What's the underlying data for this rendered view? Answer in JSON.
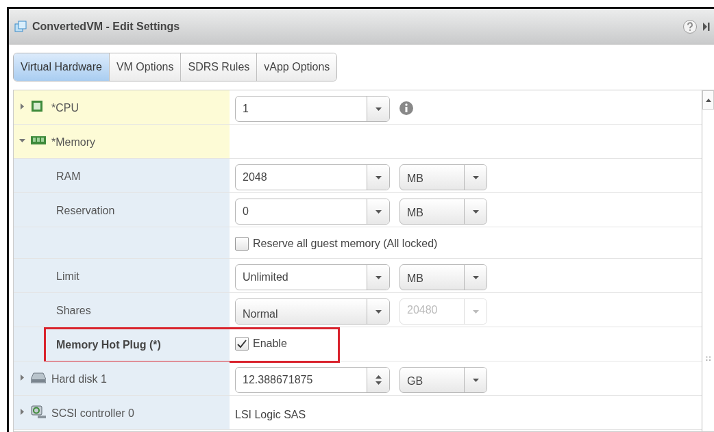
{
  "window": {
    "title": "ConvertedVM - Edit Settings"
  },
  "tabs": [
    {
      "label": "Virtual Hardware",
      "selected": true
    },
    {
      "label": "VM Options",
      "selected": false
    },
    {
      "label": "SDRS Rules",
      "selected": false
    },
    {
      "label": "vApp Options",
      "selected": false
    }
  ],
  "rows": [
    {
      "kind": "cpu",
      "label": "*CPU",
      "expanded": false,
      "changed": true,
      "control": {
        "kind": "combo",
        "value": "1"
      },
      "info": true
    },
    {
      "kind": "memory",
      "label": "*Memory",
      "expanded": true,
      "changed": true
    },
    {
      "kind": "setting",
      "label": "RAM",
      "control": {
        "kind": "combo",
        "value": "2048"
      },
      "unit": {
        "value": "MB",
        "disabled": false
      }
    },
    {
      "kind": "setting",
      "label": "Reservation",
      "control": {
        "kind": "combo",
        "value": "0"
      },
      "unit": {
        "value": "MB",
        "disabled": false
      }
    },
    {
      "kind": "setting",
      "control": {
        "kind": "checkbox",
        "label": "Reserve all guest memory (All locked)",
        "checked": false
      }
    },
    {
      "kind": "setting",
      "label": "Limit",
      "control": {
        "kind": "combo",
        "value": "Unlimited"
      },
      "unit": {
        "value": "MB",
        "disabled": false
      }
    },
    {
      "kind": "setting",
      "label": "Shares",
      "control": {
        "kind": "dropdown",
        "value": "Normal"
      },
      "unit": {
        "value": "20480",
        "disabled": true
      }
    },
    {
      "kind": "setting",
      "label": "Memory Hot Plug (*)",
      "emphasized": true,
      "highlighted": true,
      "control": {
        "kind": "checkbox",
        "label": "Enable",
        "checked": true
      }
    },
    {
      "kind": "disk",
      "label": "Hard disk 1",
      "expanded": false,
      "changed": false,
      "control": {
        "kind": "spinner",
        "value": "12.388671875"
      },
      "unit": {
        "value": "GB",
        "disabled": false
      }
    },
    {
      "kind": "scsi",
      "label": "SCSI controller 0",
      "expanded": false,
      "changed": false,
      "control": {
        "kind": "text",
        "value": "LSI Logic SAS"
      }
    }
  ]
}
